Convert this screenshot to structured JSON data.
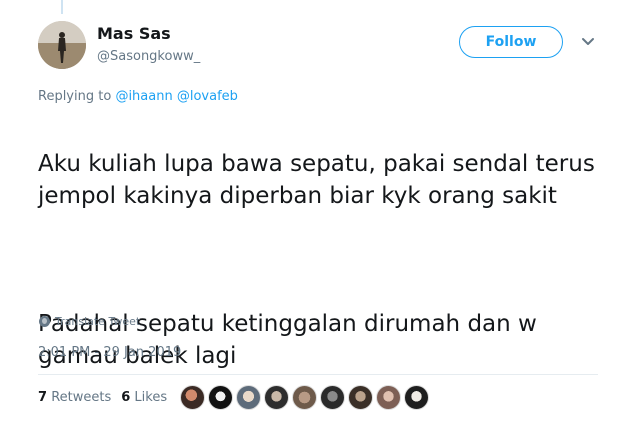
{
  "author": {
    "display_name": "Mas Sas",
    "handle": "@Sasongkoww_",
    "avatar_icon": "person-on-beach-avatar"
  },
  "actions": {
    "follow_label": "Follow",
    "menu_icon": "chevron-down-icon"
  },
  "reply": {
    "prefix": "Replying to",
    "mentions": [
      "@ihaann",
      "@lovafeb"
    ]
  },
  "tweet": {
    "paragraphs": [
      "Aku kuliah lupa bawa sepatu, pakai sendal terus jempol kakinya diperban biar kyk orang sakit",
      "Padahal sepatu ketinggalan dirumah dan w gamau balek lagi"
    ],
    "translate_label": "Translate Tweet",
    "timestamp": "2:01 PM - 29 Jan 2019"
  },
  "stats": {
    "retweets_count": "7",
    "retweets_label": "Retweets",
    "likes_count": "6",
    "likes_label": "Likes"
  },
  "likers": [
    "liker-1",
    "liker-2",
    "liker-3",
    "liker-4",
    "liker-5",
    "liker-6",
    "liker-7",
    "liker-8",
    "liker-9"
  ],
  "colors": {
    "accent": "#1da1f2",
    "secondary_text": "#657786",
    "primary_text": "#14171a",
    "divider": "#e6ecf0"
  }
}
